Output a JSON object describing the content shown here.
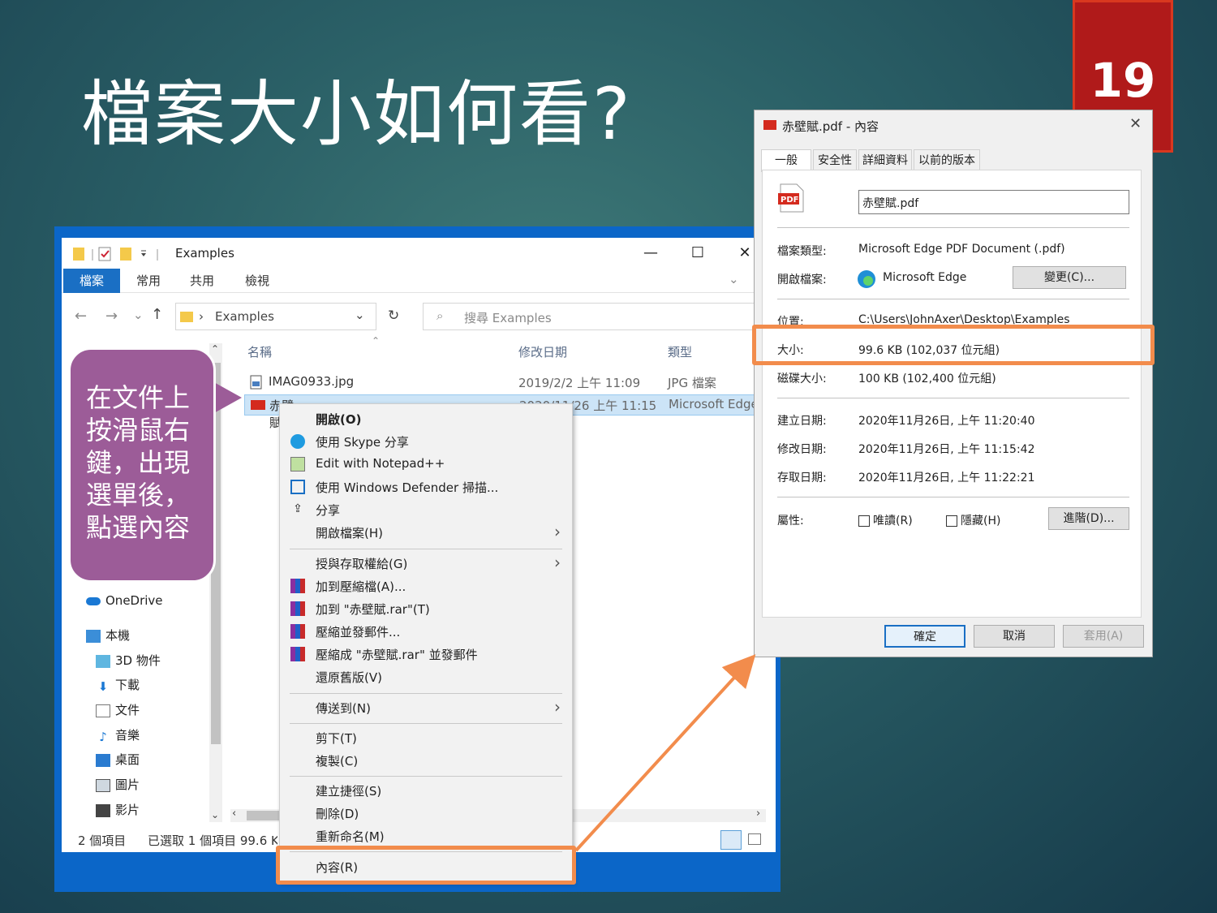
{
  "slide": {
    "title": "檔案大小如何看?",
    "page_number": "19"
  },
  "explorer": {
    "window_title": "Examples",
    "ribbon_tabs": [
      "檔案",
      "常用",
      "共用",
      "檢視"
    ],
    "address": "Examples",
    "search_placeholder": "搜尋 Examples",
    "columns": {
      "name": "名稱",
      "modified": "修改日期",
      "type": "類型"
    },
    "files": [
      {
        "name": "IMAG0933.jpg",
        "modified": "2019/2/2 上午 11:09",
        "type": "JPG 檔案"
      },
      {
        "name": "赤壁賦.pdf",
        "modified": "2020/11/26 上午 11:15",
        "type": "Microsoft Edge"
      }
    ],
    "nav": {
      "onedrive": "OneDrive",
      "this_pc": "本機",
      "items": [
        "3D 物件",
        "下載",
        "文件",
        "音樂",
        "桌面",
        "圖片",
        "影片"
      ]
    },
    "status": {
      "count": "2 個項目",
      "selected": "已選取 1 個項目 99.6 KB"
    }
  },
  "callout": {
    "lines": [
      "在文件上",
      "按滑鼠右",
      "鍵，出現",
      "選單後，",
      "點選內容"
    ]
  },
  "context_menu": {
    "items": [
      {
        "label": "開啟(O)",
        "bold": true
      },
      {
        "label": "使用 Skype 分享"
      },
      {
        "label": "Edit with Notepad++"
      },
      {
        "label": "使用 Windows Defender 掃描..."
      },
      {
        "label": "分享"
      },
      {
        "label": "開啟檔案(H)"
      },
      {
        "label": "授與存取權給(G)"
      },
      {
        "label": "加到壓縮檔(A)..."
      },
      {
        "label": "加到 \"赤壁賦.rar\"(T)"
      },
      {
        "label": "壓縮並發郵件..."
      },
      {
        "label": "壓縮成 \"赤壁賦.rar\" 並發郵件"
      },
      {
        "label": "還原舊版(V)"
      },
      {
        "label": "傳送到(N)"
      },
      {
        "label": "剪下(T)"
      },
      {
        "label": "複製(C)"
      },
      {
        "label": "建立捷徑(S)"
      },
      {
        "label": "刪除(D)"
      },
      {
        "label": "重新命名(M)"
      },
      {
        "label": "內容(R)"
      }
    ]
  },
  "properties": {
    "title": "赤壁賦.pdf - 內容",
    "tabs": [
      "一般",
      "安全性",
      "詳細資料",
      "以前的版本"
    ],
    "file_name": "赤壁賦.pdf",
    "file_type_label": "檔案類型:",
    "file_type": "Microsoft Edge PDF Document (.pdf)",
    "open_with_label": "開啟檔案:",
    "open_with": "Microsoft Edge",
    "change_button": "變更(C)...",
    "location_label": "位置:",
    "location": "C:\\Users\\JohnAxer\\Desktop\\Examples",
    "size_label": "大小:",
    "size": "99.6 KB (102,037 位元組)",
    "disk_size_label": "磁碟大小:",
    "disk_size": "100 KB (102,400 位元組)",
    "created_label": "建立日期:",
    "created": "2020年11月26日, 上午 11:20:40",
    "modified_label": "修改日期:",
    "modified": "2020年11月26日, 上午 11:15:42",
    "accessed_label": "存取日期:",
    "accessed": "2020年11月26日, 上午 11:22:21",
    "attributes_label": "屬性:",
    "readonly": "唯讀(R)",
    "hidden": "隱藏(H)",
    "advanced_button": "進階(D)...",
    "ok": "確定",
    "cancel": "取消",
    "apply": "套用(A)",
    "pdf_badge": "PDF"
  },
  "colors": {
    "highlight": "#f28c4c",
    "callout": "#9c5c98",
    "badge": "#b01a1a"
  }
}
